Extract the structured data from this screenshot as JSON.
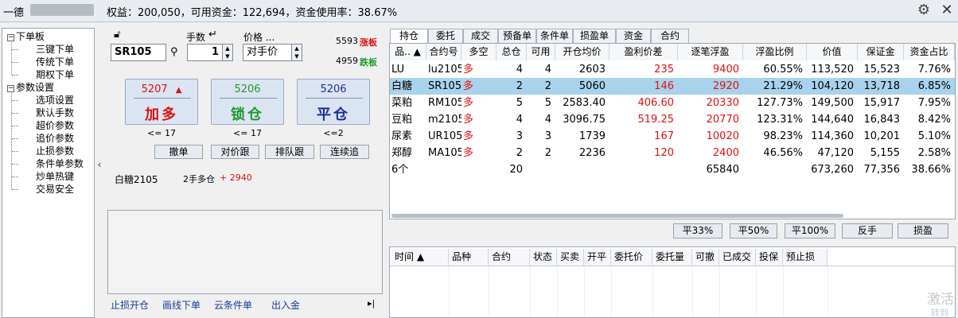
{
  "topbar": {
    "title": "一德",
    "status": "权益：200,050，可用资金：122,694，资金使用率：38.67%"
  },
  "tree": {
    "groups": [
      {
        "label": "下单板",
        "collapse_glyph": "−",
        "items": [
          "三键下单",
          "传统下单",
          "期权下单"
        ]
      },
      {
        "label": "参数设置",
        "collapse_glyph": "−",
        "items": [
          "选项设置",
          "默认手数",
          "超价参数",
          "追价参数",
          "止损参数",
          "条件单参数",
          "炒单热键",
          "交易安全"
        ]
      }
    ]
  },
  "order": {
    "lots_label": "手数",
    "price_label": "价格 ...",
    "contract": "SR105",
    "lots": "1",
    "price_type": "对手价",
    "limit_up_price": "5593",
    "limit_up_label": "涨板",
    "limit_down_price": "4959",
    "limit_down_label": "跌板",
    "buttons": [
      {
        "price": "5207",
        "arrow": "▲",
        "label": "加多",
        "limit": "<= 17",
        "color": "#e01010",
        "price_color": "#e01010"
      },
      {
        "price": "5206",
        "arrow": "",
        "label": "锁仓",
        "limit": "<= 17",
        "color": "#1f9a2a",
        "price_color": "#1f9a2a"
      },
      {
        "price": "5206",
        "arrow": "",
        "label": "平仓",
        "limit": "<=2",
        "color": "#1a2f9c",
        "price_color": "#1a2f9c"
      }
    ],
    "small_buttons": [
      "撤单",
      "对价跟",
      "排队跟",
      "连续追"
    ],
    "info_contract": "白糖2105",
    "info_position": "2手多仓",
    "info_pnl": "+ 2940",
    "links": [
      "止损开仓",
      "画线下单",
      "云条件单",
      "出入金"
    ],
    "links_end": "▸|"
  },
  "tabs": [
    "持仓",
    "委托",
    "成交",
    "预备单",
    "条件单",
    "损盈单",
    "资金",
    "合约"
  ],
  "positions": {
    "headers": [
      "品.. ▲",
      "合约号",
      "多空",
      "总仓",
      "可用",
      "开仓均价",
      "盈利价差",
      "逐笔浮盈",
      "浮盈比例",
      "价值",
      "保证金",
      "资金占比"
    ],
    "rows": [
      [
        "LU",
        "lu2105",
        "多",
        "4",
        "4",
        "2603",
        "235",
        "9400",
        "60.55%",
        "113,520",
        "15,523",
        "7.76%"
      ],
      [
        "白糖",
        "SR105",
        "多",
        "2",
        "2",
        "5060",
        "146",
        "2920",
        "21.29%",
        "104,120",
        "13,718",
        "6.85%"
      ],
      [
        "菜粕",
        "RM105",
        "多",
        "5",
        "5",
        "2583.40",
        "406.60",
        "20330",
        "127.73%",
        "149,500",
        "15,917",
        "7.95%"
      ],
      [
        "豆粕",
        "m2105",
        "多",
        "4",
        "4",
        "3096.75",
        "519.25",
        "20770",
        "123.31%",
        "144,640",
        "16,843",
        "8.42%"
      ],
      [
        "尿素",
        "UR105",
        "多",
        "3",
        "3",
        "1739",
        "167",
        "10020",
        "98.23%",
        "114,360",
        "10,201",
        "5.10%"
      ],
      [
        "郑醇",
        "MA105",
        "多",
        "2",
        "2",
        "2236",
        "120",
        "2400",
        "46.56%",
        "47,120",
        "5,155",
        "2.58%"
      ]
    ],
    "total": [
      "6个",
      "",
      "",
      "20",
      "",
      "",
      "",
      "65840",
      "",
      "673,260",
      "77,356",
      "38.66%"
    ],
    "selected_row": 1
  },
  "position_buttons": [
    "平33%",
    "平50%",
    "平100%",
    "反手",
    "损盈"
  ],
  "orders": {
    "headers": [
      "时间 ▲",
      "品种",
      "合约",
      "状态",
      "买卖",
      "开平",
      "委托价",
      "委托量",
      "可撤",
      "已成交",
      "投保",
      "预止损"
    ]
  },
  "watermark": "激活",
  "watermark2": "转到"
}
